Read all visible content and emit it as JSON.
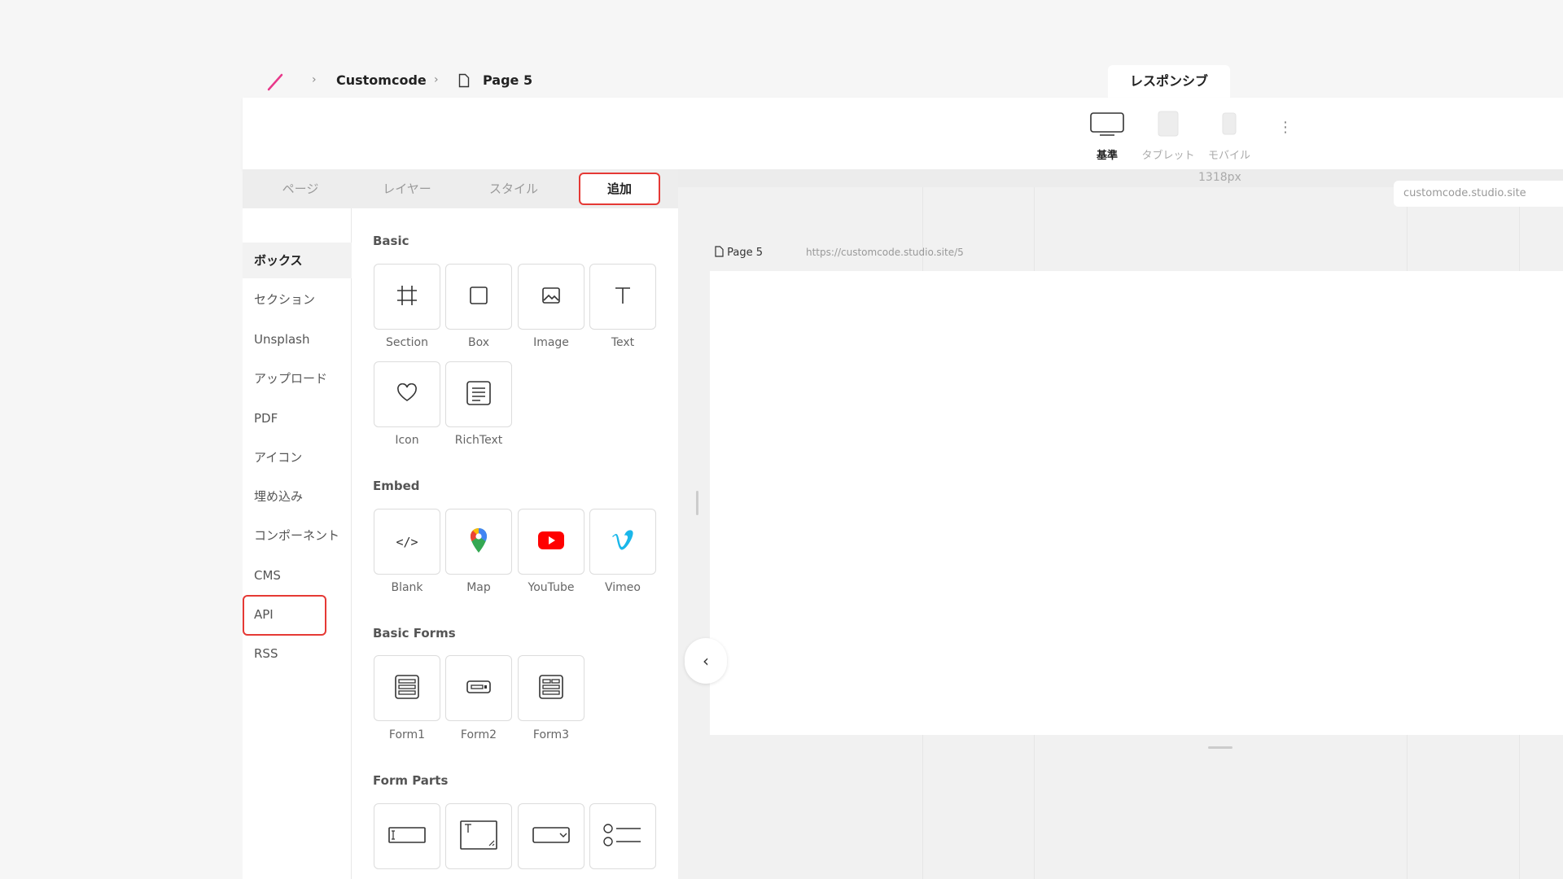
{
  "breadcrumb": {
    "project": "Customcode",
    "page": "Page 5"
  },
  "responsive_tab": "レスポンシブ",
  "devices": [
    {
      "label": "基準",
      "icon": "desktop-icon"
    },
    {
      "label": "タブレット",
      "icon": "tablet-icon"
    },
    {
      "label": "モバイル",
      "icon": "mobile-icon"
    }
  ],
  "tabs": [
    "ページ",
    "レイヤー",
    "スタイル",
    "追加"
  ],
  "categories": [
    "ボックス",
    "セクション",
    "Unsplash",
    "アップロード",
    "PDF",
    "アイコン",
    "埋め込み",
    "コンポーネント",
    "CMS",
    "API",
    "RSS"
  ],
  "sections": {
    "basic": {
      "title": "Basic",
      "items": [
        "Section",
        "Box",
        "Image",
        "Text",
        "Icon",
        "RichText"
      ]
    },
    "embed": {
      "title": "Embed",
      "items": [
        "Blank",
        "Map",
        "YouTube",
        "Vimeo"
      ]
    },
    "basic_forms": {
      "title": "Basic Forms",
      "items": [
        "Form1",
        "Form2",
        "Form3"
      ]
    },
    "form_parts": {
      "title": "Form Parts"
    }
  },
  "canvas": {
    "width_label": "1318px",
    "domain": "customcode.studio.site",
    "page_label": "Page 5",
    "page_url": "https://customcode.studio.site/5"
  },
  "colors": {
    "accent_red": "#e53935",
    "logo_pink": "#e8388a",
    "youtube_red": "#ff0000",
    "vimeo_blue": "#1ab7ea"
  }
}
